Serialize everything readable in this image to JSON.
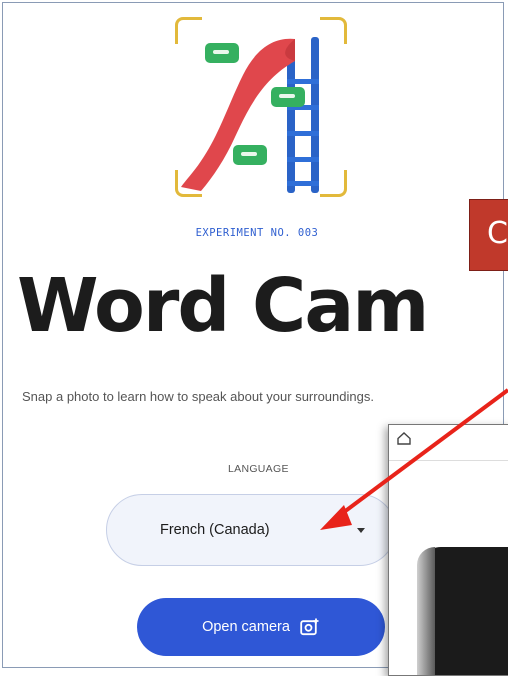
{
  "experiment_label": "EXPERIMENT NO. 003",
  "title": "Word Cam",
  "subtitle": "Snap a photo to learn how to speak about your surroundings.",
  "language": {
    "label": "LANGUAGE",
    "selected": "French (Canada)"
  },
  "camera_button": {
    "label": "Open camera",
    "icon": "add-photo-icon"
  },
  "annotation_box_text": "C",
  "colors": {
    "accent": "#2f57d6",
    "experiment_text": "#2f5fd0",
    "bracket": "#e2b93b",
    "annotation_red": "#c0392b",
    "arrow_red": "#e8231a"
  },
  "overlay_window": {
    "icon": "home-icon"
  }
}
